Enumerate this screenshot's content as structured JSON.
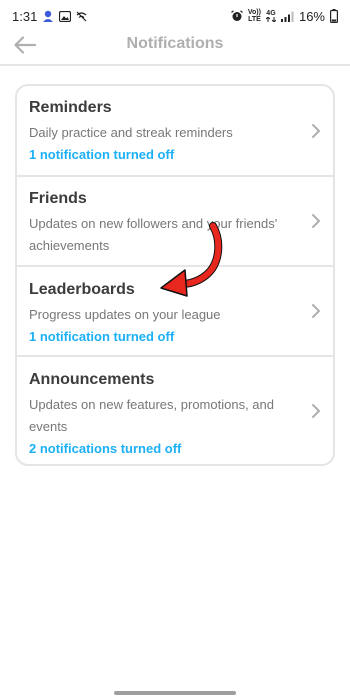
{
  "status_bar": {
    "time": "1:31",
    "network_label_top": "Vo))",
    "network_label_bottom": "LTE",
    "network_4g_top": "4G",
    "battery": "16%"
  },
  "header": {
    "title": "Notifications"
  },
  "settings": [
    {
      "title": "Reminders",
      "description": "Daily practice and streak reminders",
      "status": "1 notification turned off"
    },
    {
      "title": "Friends",
      "description": "Updates on new followers and your friends' achievements",
      "status": ""
    },
    {
      "title": "Leaderboards",
      "description": "Progress updates on your league",
      "status": "1 notification turned off"
    },
    {
      "title": "Announcements",
      "description": "Updates on new features, promotions, and events",
      "status": "2 notifications turned off"
    }
  ],
  "colors": {
    "accent_status": "#1cb0f6",
    "annotation_arrow": "#e8281f",
    "title_gray": "#afafaf",
    "divider": "#e5e5e5"
  },
  "icons": {
    "back": "arrow-left-icon",
    "chevron": "chevron-right-icon"
  }
}
